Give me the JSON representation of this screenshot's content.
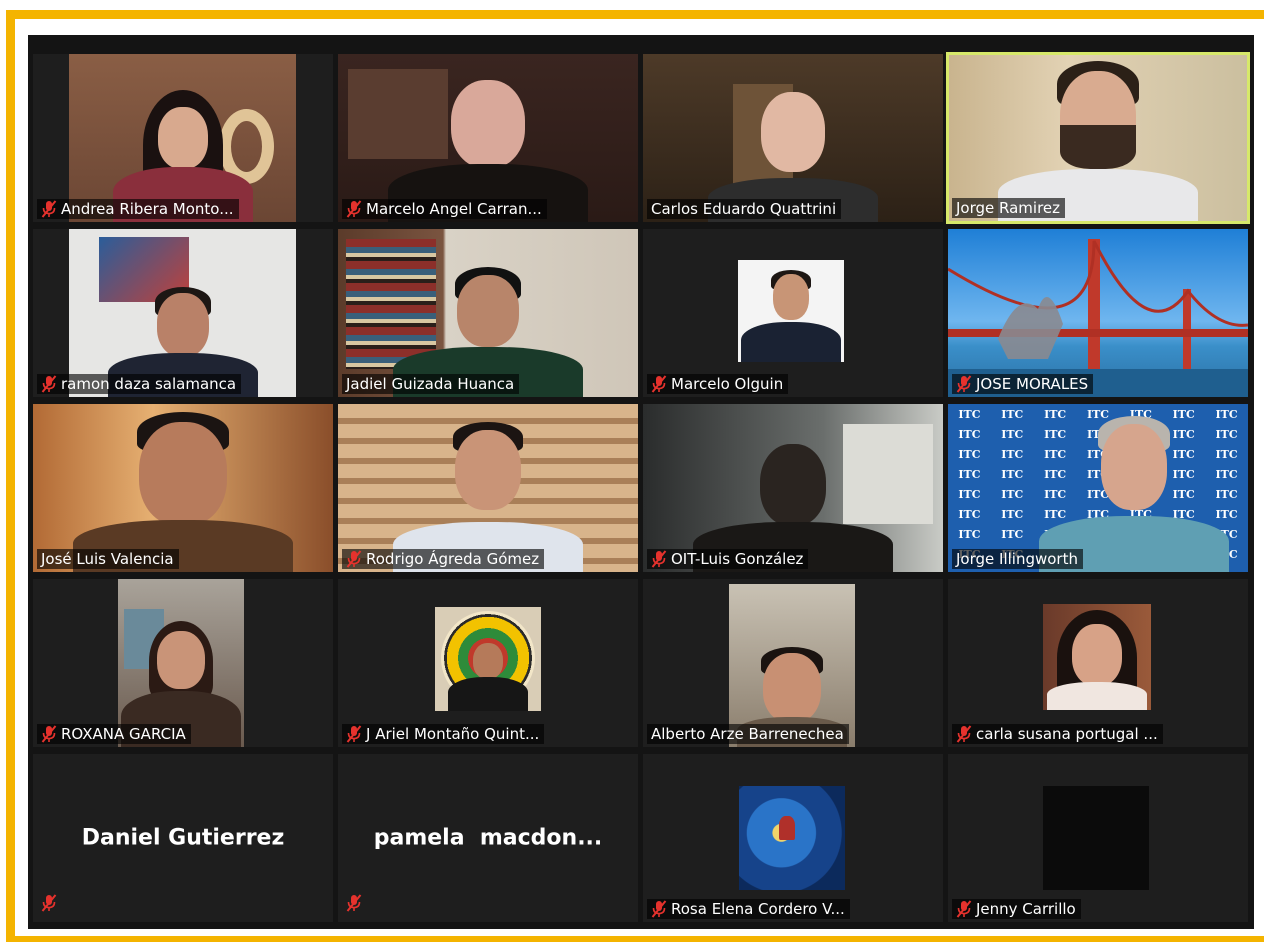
{
  "colors": {
    "frame": "#F4B400",
    "background": "#141414",
    "tile": "#1e1e1e",
    "active_speaker": "#d7e86a",
    "mute_icon": "#e5322d"
  },
  "participants": [
    {
      "name": "Andrea Ribera Monto...",
      "muted": true
    },
    {
      "name": "Marcelo Angel Carran...",
      "muted": true
    },
    {
      "name": "Carlos Eduardo Quattrini",
      "muted": false
    },
    {
      "name": "Jorge Ramirez",
      "muted": false,
      "active": true
    },
    {
      "name": "ramon daza salamanca",
      "muted": true
    },
    {
      "name": "Jadiel Guizada Huanca",
      "muted": false
    },
    {
      "name": "Marcelo Olguin",
      "muted": true
    },
    {
      "name": "JOSE MORALES",
      "muted": true
    },
    {
      "name": "José Luis Valencia",
      "muted": false
    },
    {
      "name": "Rodrigo Ágreda Gómez",
      "muted": true
    },
    {
      "name": "OIT-Luis González",
      "muted": true
    },
    {
      "name": "Jorge Illingworth",
      "muted": false
    },
    {
      "name": "ROXANA GARCIA",
      "muted": true
    },
    {
      "name": "J Ariel Montaño Quint...",
      "muted": true
    },
    {
      "name": "Alberto Arze Barrenechea",
      "muted": false
    },
    {
      "name": "carla susana portugal ...",
      "muted": true
    },
    {
      "name": "Daniel Gutierrez",
      "muted": true,
      "video_off": true
    },
    {
      "name": "pamela  macdon...",
      "muted": true,
      "video_off": true
    },
    {
      "name": "Rosa Elena Cordero V...",
      "muted": true
    },
    {
      "name": "Jenny Carrillo",
      "muted": true
    }
  ],
  "logo_text": "ITC"
}
